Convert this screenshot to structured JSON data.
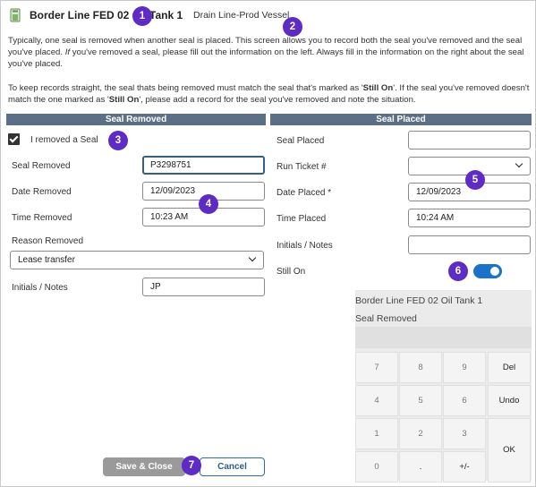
{
  "header": {
    "title": "Border Line FED 02 Oil Tank 1",
    "subtitle": "Drain Line-Prod Vessel",
    "icon": "tank-gauge-icon"
  },
  "intro": {
    "para1_a": "Typically, one seal is removed when another seal is placed.  This screen allows you to record both the seal you've removed and the seal you've placed.  ",
    "para1_b": "If",
    "para1_c": " you've removed a seal, please fill out the information on the left. Always fill in the information on the right about the seal you've placed.",
    "para2_a": "To keep records straight, the seal thats being removed must match the seal that's marked as '",
    "para2_b": "Still On",
    "para2_c": "'.  If the seal you've removed doesn't match the one marked as '",
    "para2_d": "Still On",
    "para2_e": "', please add a record for the seal you've removed and note the situation."
  },
  "removed": {
    "header": "Seal Removed",
    "checkbox_label": "I removed a Seal",
    "seal_label": "Seal Removed",
    "seal_value": "P3298751",
    "date_label": "Date Removed",
    "date_value": "12/09/2023",
    "time_label": "Time Removed",
    "time_value": "10:23 AM",
    "reason_label": "Reason Removed",
    "reason_value": "Lease transfer",
    "notes_label": "Initials / Notes",
    "notes_value": "JP"
  },
  "placed": {
    "header": "Seal Placed",
    "seal_label": "Seal Placed",
    "seal_value": "",
    "ticket_label": "Run Ticket #",
    "ticket_value": "",
    "date_label": "Date Placed *",
    "date_value": "12/09/2023",
    "time_label": "Time Placed",
    "time_value": "10:24 AM",
    "notes_label": "Initials / Notes",
    "notes_value": "",
    "still_on_label": "Still On"
  },
  "keypad": {
    "line1": "Border Line FED 02 Oil Tank 1",
    "line2": "Seal Removed",
    "keys": [
      "7",
      "8",
      "9",
      "Del",
      "4",
      "5",
      "6",
      "Undo",
      "1",
      "2",
      "3",
      "OK",
      "0",
      ".",
      "+/-"
    ]
  },
  "buttons": {
    "save": "Save & Close",
    "cancel": "Cancel"
  },
  "badges": [
    "1",
    "2",
    "3",
    "4",
    "5",
    "6",
    "7"
  ],
  "colors": {
    "section_header": "#5b6f86",
    "badge": "#5e2bc5",
    "toggle_on": "#1a73c9",
    "cancel_text": "#2d5f86"
  }
}
